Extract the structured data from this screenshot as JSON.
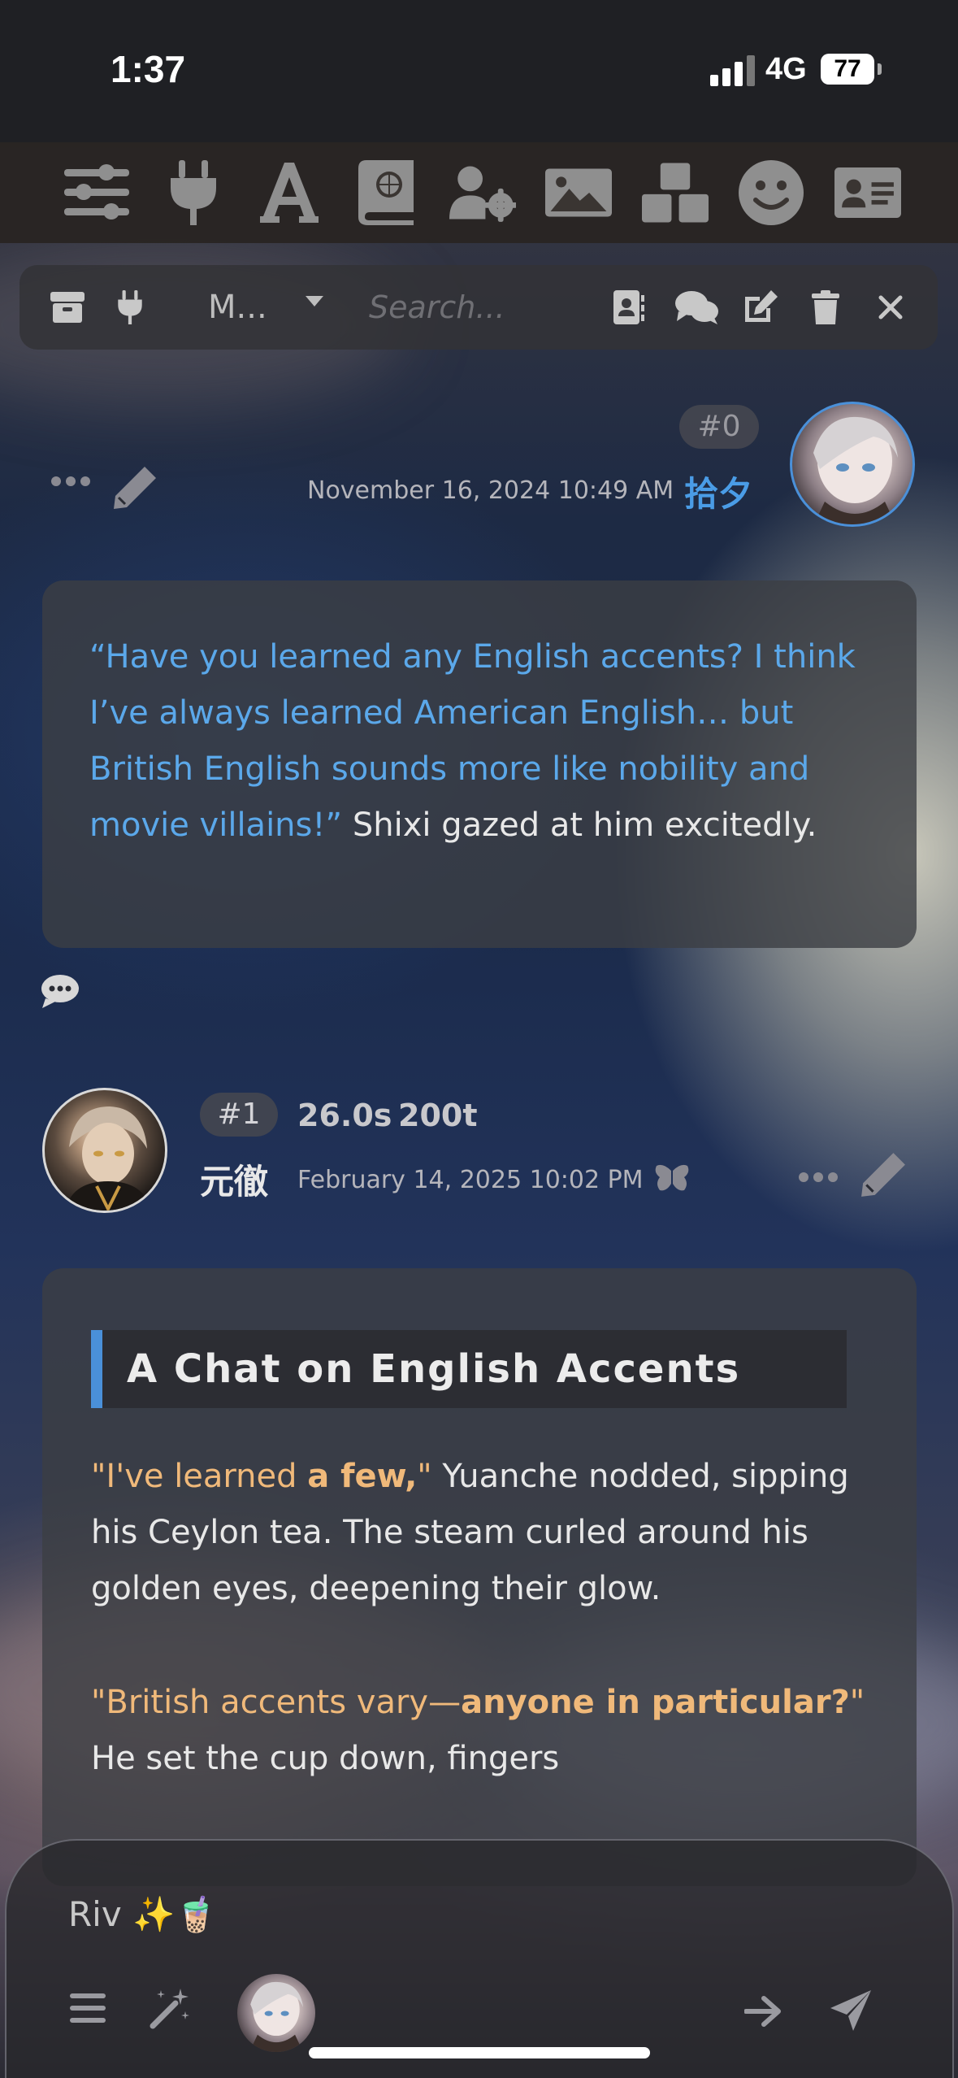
{
  "status_bar": {
    "time": "1:37",
    "network": "4G",
    "battery": "77"
  },
  "top_toolbar": {
    "icons": [
      "sliders-icon",
      "plug-icon",
      "font-icon",
      "book-globe-icon",
      "user-gear-icon",
      "image-icon",
      "cubes-icon",
      "smile-icon",
      "id-card-icon"
    ]
  },
  "chat_toolbar": {
    "model_label": "M...",
    "search_placeholder": "Search..."
  },
  "messages": [
    {
      "id": "#0",
      "timestamp": "November 16, 2024 10:49 AM",
      "name": "拾夕",
      "quote": "“Have you learned any English accents? I think I’ve always learned American English… but British English sounds more like nobility and movie villains!”",
      "narration": " Shixi gazed at him excitedly."
    },
    {
      "id": "#1",
      "timing": "26.0s",
      "tokens": "200t",
      "name": "元徹",
      "timestamp": "February 14, 2025 10:02 PM",
      "heading": "A Chat on English Accents",
      "p1_quote_a": "\"I've learned ",
      "p1_quote_b": "a few,",
      "p1_quote_c": "\"",
      "p1_rest": " Yuanche nodded, sipping his Ceylon tea. The steam curled around his golden eyes, deepening their glow.",
      "p2_quote_a": "\"British accents vary—",
      "p2_quote_b": "anyone in particular?",
      "p2_quote_c": "\"",
      "p2_rest": " He set the cup down, fingers"
    }
  ],
  "input": {
    "text": "Riv ✨🧋"
  }
}
